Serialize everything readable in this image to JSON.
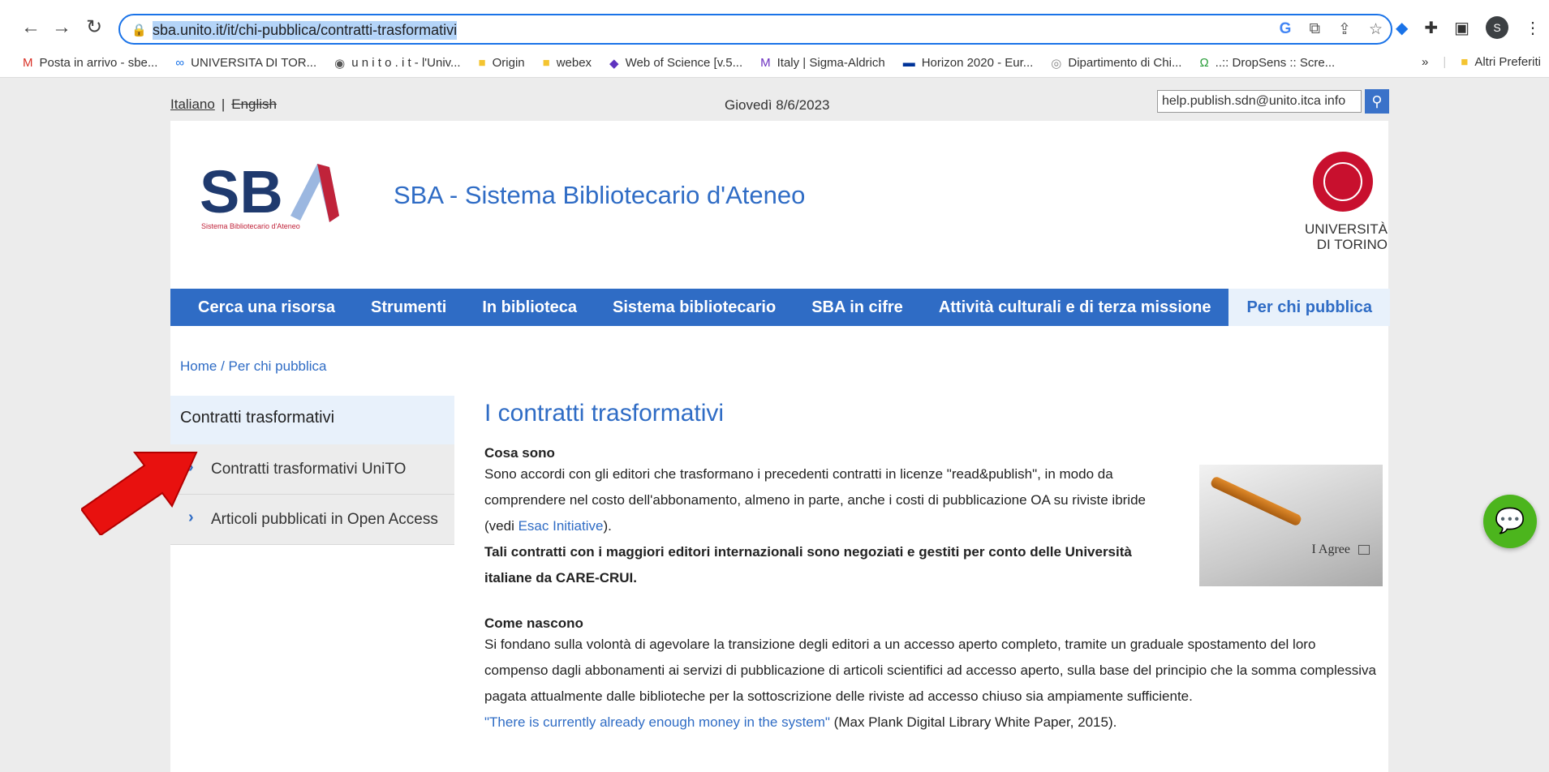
{
  "browser": {
    "url": "sba.unito.it/it/chi-pubblica/contratti-trasformativi",
    "profile_initial": "S",
    "bookmarks": [
      {
        "label": "Posta in arrivo - sbe...",
        "icon": "gmail-icon",
        "glyph": "M",
        "color": "#d93025"
      },
      {
        "label": "UNIVERSITA DI TOR...",
        "icon": "link-icon",
        "glyph": "∞",
        "color": "#1a73e8"
      },
      {
        "label": "u n i t o . i t - l'Univ...",
        "icon": "globe-icon",
        "glyph": "◉",
        "color": "#555"
      },
      {
        "label": "Origin",
        "icon": "folder-icon",
        "glyph": "■",
        "color": "#f4c430"
      },
      {
        "label": "webex",
        "icon": "folder-icon",
        "glyph": "■",
        "color": "#f4c430"
      },
      {
        "label": "Web of Science [v.5...",
        "icon": "wos-icon",
        "glyph": "◆",
        "color": "#5e33bf"
      },
      {
        "label": "Italy | Sigma-Aldrich",
        "icon": "sigma-icon",
        "glyph": "M",
        "color": "#6b2fbf"
      },
      {
        "label": "Horizon 2020 - Eur...",
        "icon": "eu-flag-icon",
        "glyph": "▬",
        "color": "#003399"
      },
      {
        "label": "Dipartimento di Chi...",
        "icon": "dept-icon",
        "glyph": "◎",
        "color": "#888"
      },
      {
        "label": "..:: DropSens :: Scre...",
        "icon": "dropsens-icon",
        "glyph": "Ω",
        "color": "#2a9d3a"
      }
    ],
    "more_bookmarks": "»",
    "other_bookmarks": "Altri Preferiti"
  },
  "page": {
    "lang_it": "Italiano",
    "lang_en": "English",
    "date": "Giovedì 8/6/2023",
    "search_value": "help.publish.sdn@unito.itca info",
    "site_title": "SBA - Sistema Bibliotecario d'Ateneo",
    "sba_logo_text": "SB",
    "sba_logo_sub": "Sistema Bibliotecario d'Ateneo",
    "unito_line1": "UNIVERSITÀ",
    "unito_line2": "DI TORINO",
    "menu": [
      "Cerca una risorsa",
      "Strumenti",
      "In biblioteca",
      "Sistema bibliotecario",
      "SBA in cifre",
      "Attività culturali e di terza missione",
      "Per chi pubblica"
    ],
    "breadcrumb_home": "Home",
    "breadcrumb_sep": " / ",
    "breadcrumb_current": "Per chi pubblica",
    "sidebar_head": "Contratti trasformativi",
    "sidebar_items": [
      "Contratti trasformativi UniTO",
      "Articoli pubblicati in Open Access"
    ],
    "heading": "I contratti trasformativi",
    "s1_title": "Cosa sono",
    "s1_text_a": "Sono accordi con gli editori che trasformano i precedenti contratti in licenze \"read&publish\", in modo da comprendere nel costo dell'abbonamento, almeno in parte, anche i costi di pubblicazione OA su riviste ibride (vedi ",
    "s1_link": "Esac Initiative",
    "s1_text_b": ").",
    "s1_bold": "Tali contratti con i maggiori editori internazionali sono negoziati e gestiti per conto delle Università italiane da CARE-CRUI.",
    "s2_title": "Come nascono",
    "s2_text": "Si fondano sulla volontà di agevolare la transizione degli editori a un accesso aperto completo, tramite un graduale spostamento del loro compenso dagli abbonamenti ai servizi di pubblicazione di articoli scientifici ad accesso aperto, sulla base del principio che la somma complessiva pagata attualmente dalle biblioteche per la sottoscrizione delle riviste ad accesso chiuso sia ampiamente sufficiente.",
    "s2_link": "\"There is currently already enough money in the system\"",
    "s2_text_b": " (Max Plank Digital Library White Paper, 2015).",
    "img_text": "I Agree"
  }
}
